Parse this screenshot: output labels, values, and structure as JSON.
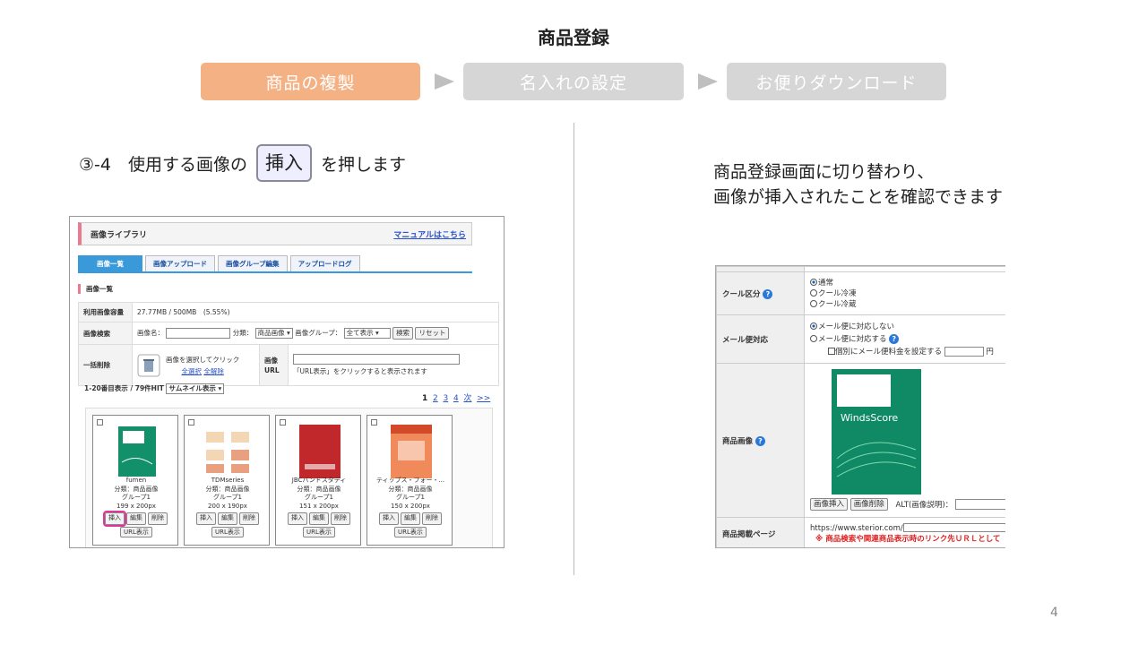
{
  "title": "商品登録",
  "steps": [
    "商品の複製",
    "名入れの設定",
    "お便りダウンロード"
  ],
  "colors": {
    "step_active": "#f4b183",
    "step_inactive": "#d6d6d6",
    "arrow": "#bfbfbf",
    "highlight": "#e0359a"
  },
  "instruction": {
    "prefix": "③-4　使用する画像の",
    "chip": "挿入",
    "suffix": "を押します"
  },
  "confirm": {
    "line1": "商品登録画面に切り替わり、",
    "line2": "画像が挿入されたことを確認できます"
  },
  "page_number": "4",
  "library": {
    "title": "画像ライブラリ",
    "manual_link": "マニュアルはこちら",
    "tabs": [
      "画像一覧",
      "画像アップロード",
      "画像グループ編集",
      "アップロードログ"
    ],
    "section": "画像一覧",
    "usage_label": "利用画像容量",
    "usage_value": "27.77MB / 500MB　(5.55%)",
    "search_label": "画像検索",
    "search_name": "画像名：",
    "search_cat": "分類：",
    "search_cat_value": "商品画像",
    "search_group": "画像グループ：",
    "search_group_value": "全て表示",
    "search_btn": "検索",
    "reset_btn": "リセット",
    "bulk_label": "一括削除",
    "bulk_hint": "画像を選択してクリック",
    "select_all": "全選択",
    "deselect_all": "全解除",
    "url_label1": "画像",
    "url_label2": "URL",
    "url_hint": "「URL表示」をクリックすると表示されます",
    "hits": "1-20番目表示 / 79件HIT",
    "view_mode": "サムネイル表示",
    "pages": [
      "1",
      "2",
      "3",
      "4",
      "次",
      ">>"
    ],
    "cards": [
      {
        "name": "fumen",
        "cat": "分類：商品画像",
        "group": "グループ1",
        "size": "199 x 200px"
      },
      {
        "name": "TDMseries",
        "cat": "分類：商品画像",
        "group": "グループ1",
        "size": "200 x 190px"
      },
      {
        "name": "JBCバンドスタディ",
        "cat": "分類：商品画像",
        "group": "グループ1",
        "size": "151 x 200px"
      },
      {
        "name": "ティップス・フォー・...",
        "cat": "分類：商品画像",
        "group": "グループ1",
        "size": "150 x 200px"
      }
    ],
    "btn_insert": "挿入",
    "btn_edit": "編集",
    "btn_delete": "削除",
    "btn_url": "URL表示"
  },
  "form": {
    "cool_label": "クール区分",
    "cool_options": [
      "通常",
      "クール冷凍",
      "クール冷蔵"
    ],
    "mail_label": "メール便対応",
    "mail_options": [
      "メール便に対応しない",
      "メール便に対応する"
    ],
    "mail_fee": "個別にメール便料金を設定する",
    "mail_yen": "円",
    "image_label": "商品画像",
    "img_insert": "画像挿入",
    "img_delete": "画像削除",
    "alt_label": "ALT(画像説明)：",
    "book_title": "WindsScore",
    "page_label": "商品掲載ページ",
    "page_url": "https://www.sterior.com/",
    "page_note": "※ 商品検索や関連商品表示時のリンク先ＵＲＬとして"
  }
}
